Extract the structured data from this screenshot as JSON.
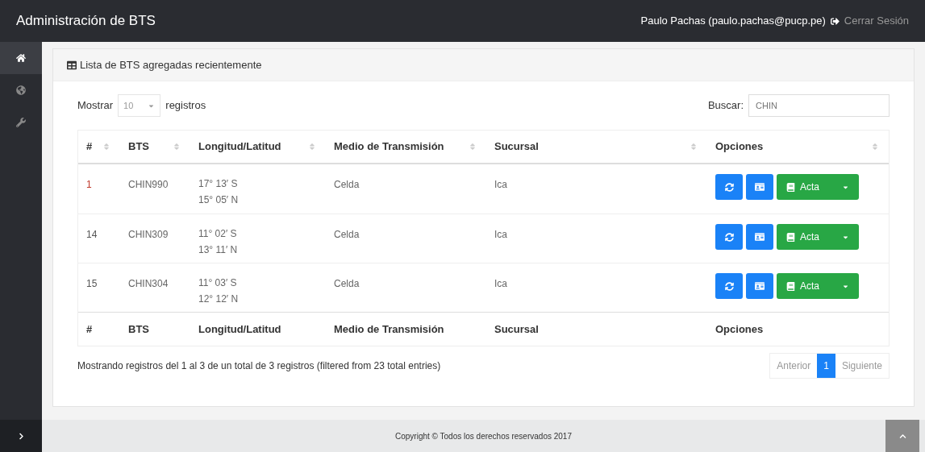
{
  "header": {
    "title": "Administración de BTS",
    "user": "Paulo Pachas (paulo.pachas@pucp.pe)",
    "logout": "Cerrar Sesión"
  },
  "sidebar": {
    "items": [
      {
        "kind": "home",
        "selected": true
      },
      {
        "kind": "globe",
        "selected": false
      },
      {
        "kind": "wrench",
        "selected": false
      }
    ]
  },
  "panel": {
    "title": "Lista de BTS agregadas recientemente"
  },
  "length": {
    "label_before": "Mostrar",
    "value": "10",
    "label_after": "registros"
  },
  "search": {
    "label": "Buscar:",
    "value": "CHIN"
  },
  "table": {
    "columns": [
      "#",
      "BTS",
      "Longitud/Latitud",
      "Medio de Transmisión",
      "Sucursal",
      "Opciones"
    ],
    "rows": [
      {
        "num": "1",
        "bts": "CHIN990",
        "coords": [
          "17° 13′ S",
          "15° 05′ N"
        ],
        "medio": "Celda",
        "sucursal": "Ica",
        "action": "Acta",
        "color": "#c0392b"
      },
      {
        "num": "14",
        "bts": "CHIN309",
        "coords": [
          "11° 02′ S",
          "13° 11′ N"
        ],
        "medio": "Celda",
        "sucursal": "Ica",
        "action": "Acta",
        "color": "#555555"
      },
      {
        "num": "15",
        "bts": "CHIN304",
        "coords": [
          "11° 03′ S",
          "12° 12′ N"
        ],
        "medio": "Celda",
        "sucursal": "Ica",
        "action": "Acta",
        "color": "#555555"
      }
    ],
    "footer_columns": [
      "#",
      "BTS",
      "Longitud/Latitud",
      "Medio de Transmisión",
      "Sucursal",
      "Opciones"
    ]
  },
  "info": "Mostrando registros del 1 al 3 de un total de 3 registros (filtered from 23 total entries)",
  "pagination": {
    "previous": "Anterior",
    "pages": [
      {
        "label": "1",
        "selected": true
      }
    ],
    "next": "Siguiente"
  },
  "footer": {
    "copyright": "Copyright © Todos los derechos reservados 2017"
  }
}
